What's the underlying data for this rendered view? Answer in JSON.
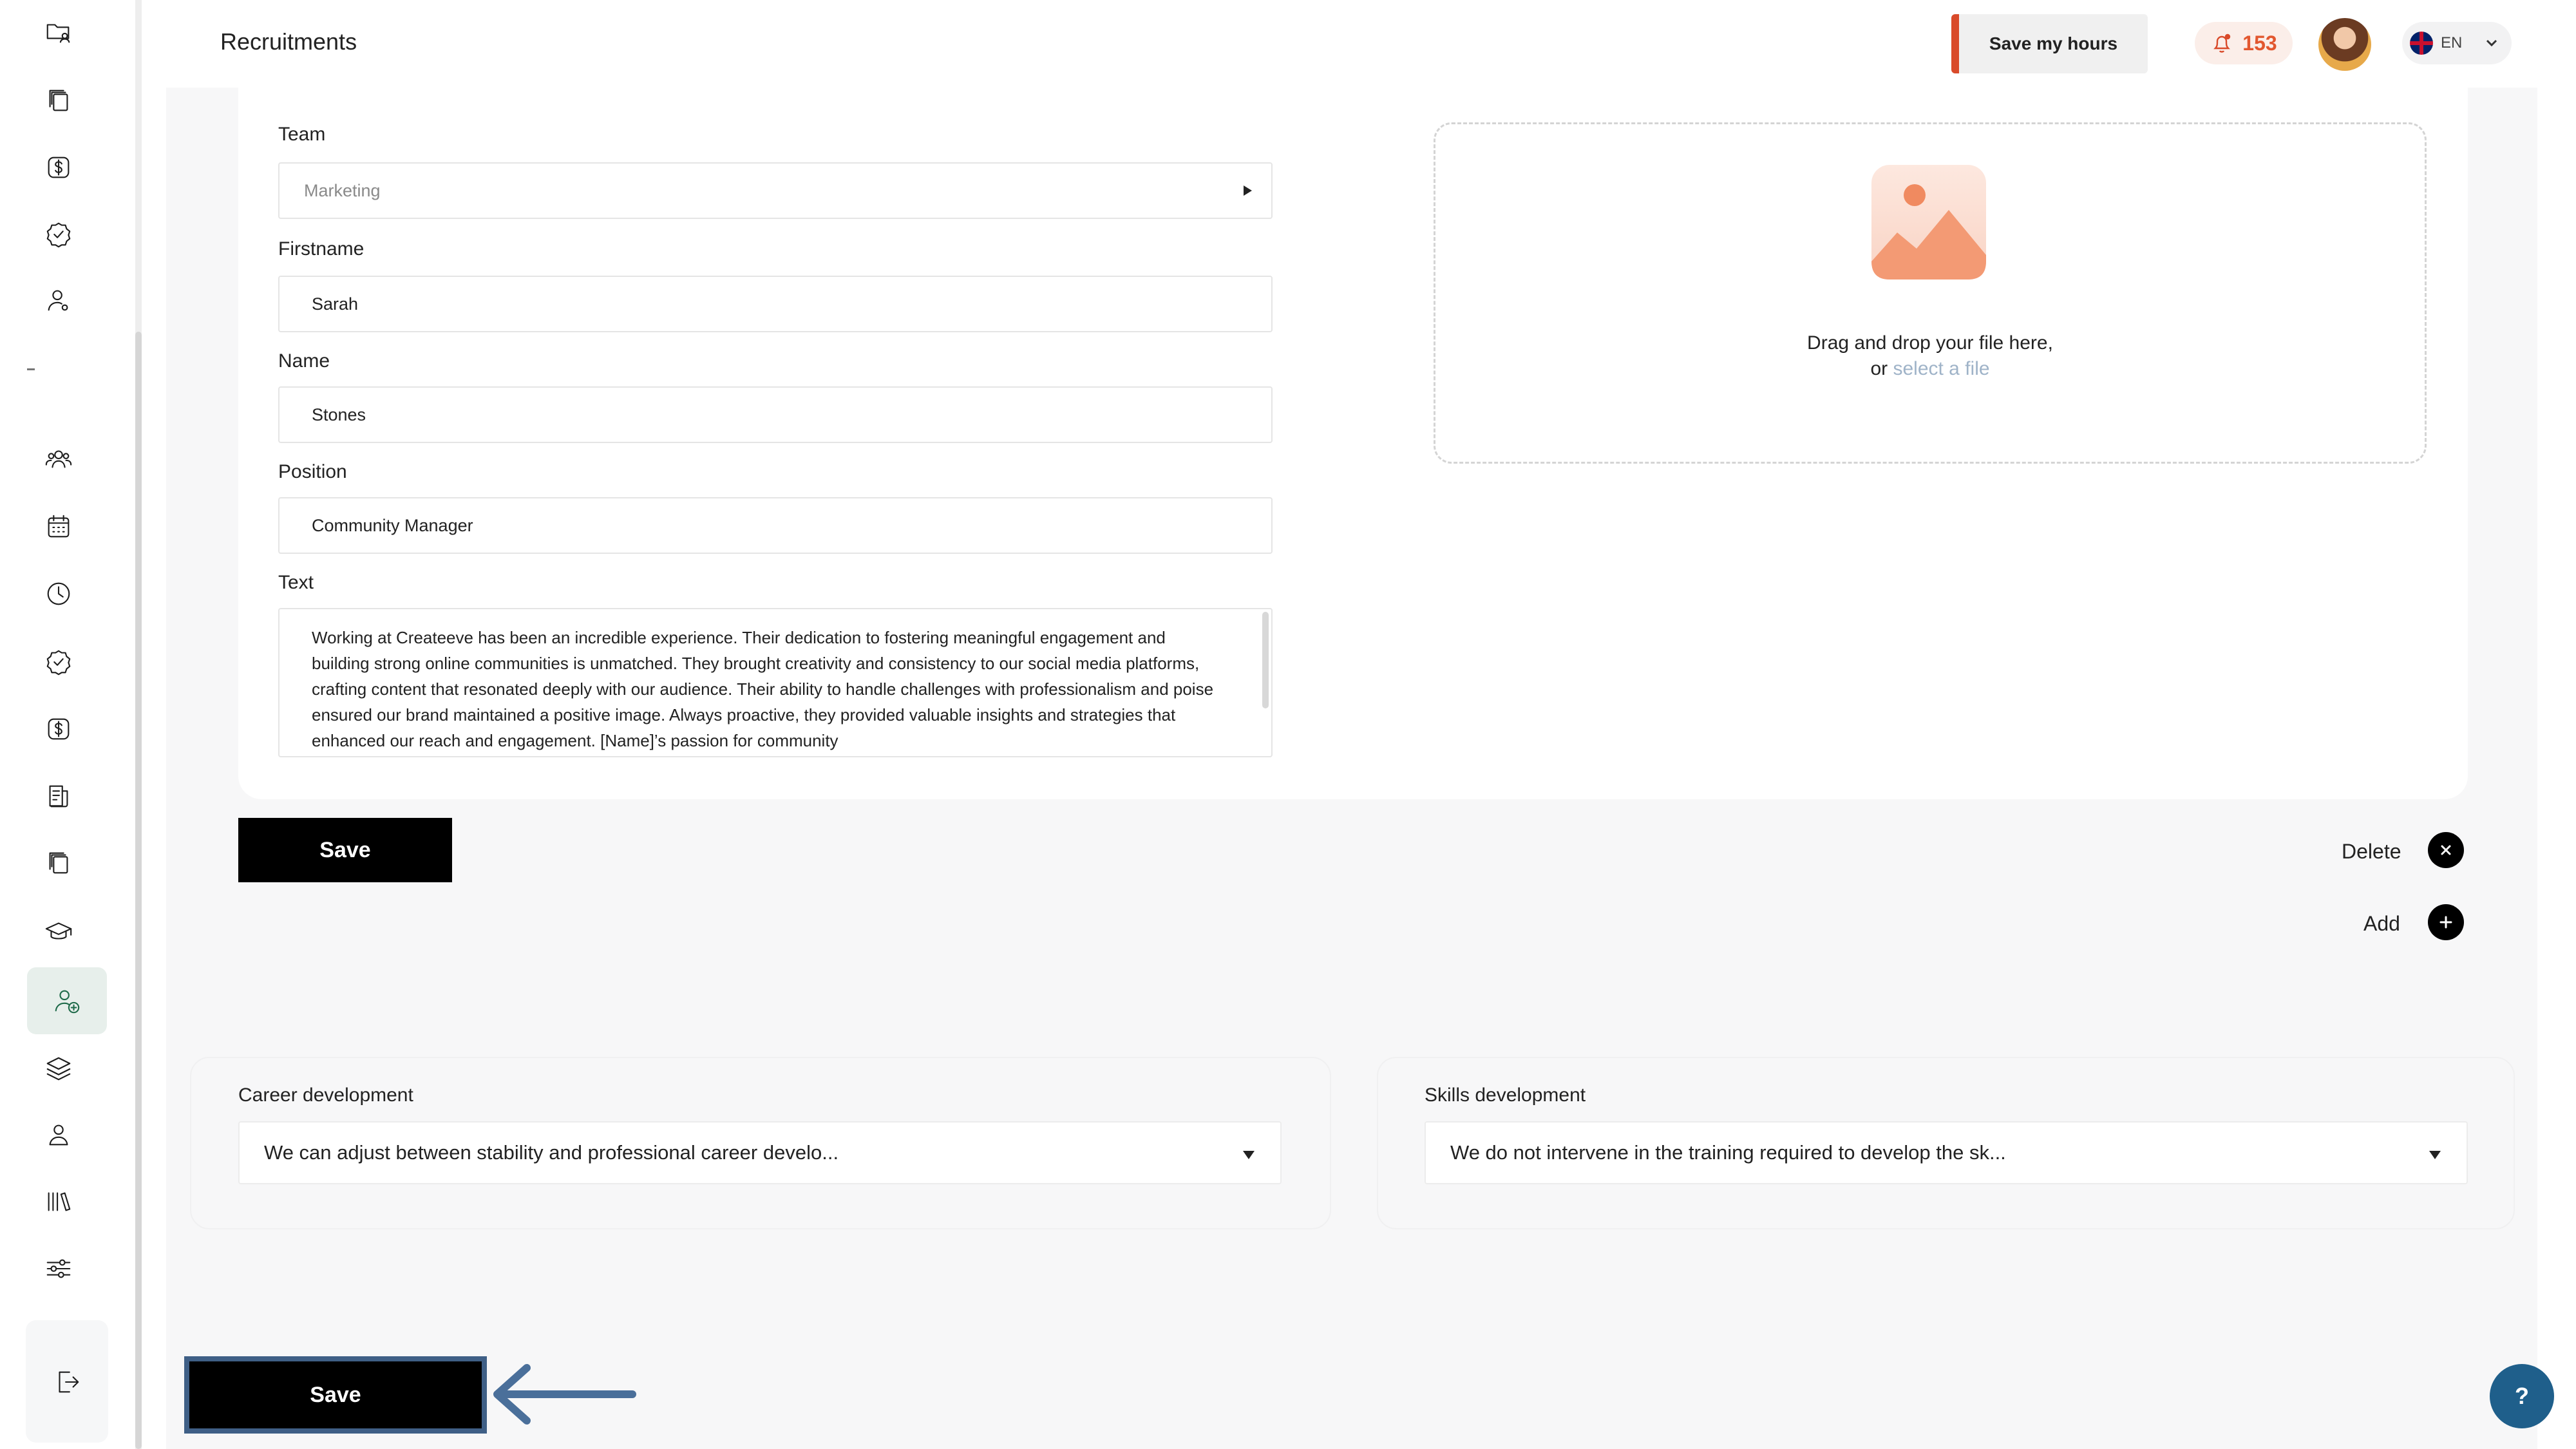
{
  "header": {
    "title": "Recruitments",
    "save_hours_label": "Save my hours",
    "notification_count": "153",
    "language": "EN"
  },
  "form": {
    "team_label": "Team",
    "team_value": "Marketing",
    "firstname_label": "Firstname",
    "firstname_value": "Sarah",
    "name_label": "Name",
    "name_value": "Stones",
    "position_label": "Position",
    "position_value": "Community Manager",
    "text_label": "Text",
    "text_value": "Working at Createeve has been an incredible experience. Their dedication to fostering meaningful engagement and building strong online communities is unmatched. They brought creativity and consistency to our social media platforms, crafting content that resonated deeply with our audience. Their ability to handle challenges with professionalism and poise ensured our brand maintained a positive image. Always proactive, they provided valuable insights and strategies that enhanced our reach and engagement. [Name]’s passion for community"
  },
  "upload": {
    "line1": "Drag and drop your file here,",
    "or_text": "or",
    "select_link": "select a file"
  },
  "actions": {
    "save_label": "Save",
    "delete_label": "Delete",
    "add_label": "Add"
  },
  "career": {
    "label": "Career development",
    "value": "We can adjust between stability and professional career develo..."
  },
  "skills": {
    "label": "Skills development",
    "value": "We do not intervene in the training required to develop the sk..."
  },
  "footer": {
    "save_label": "Save",
    "help_label": "?"
  },
  "colors": {
    "accent": "#d94a2a",
    "help": "#1f5f8b",
    "highlight_frame": "#3f5f86",
    "active_nav": "#1f6b4a"
  }
}
